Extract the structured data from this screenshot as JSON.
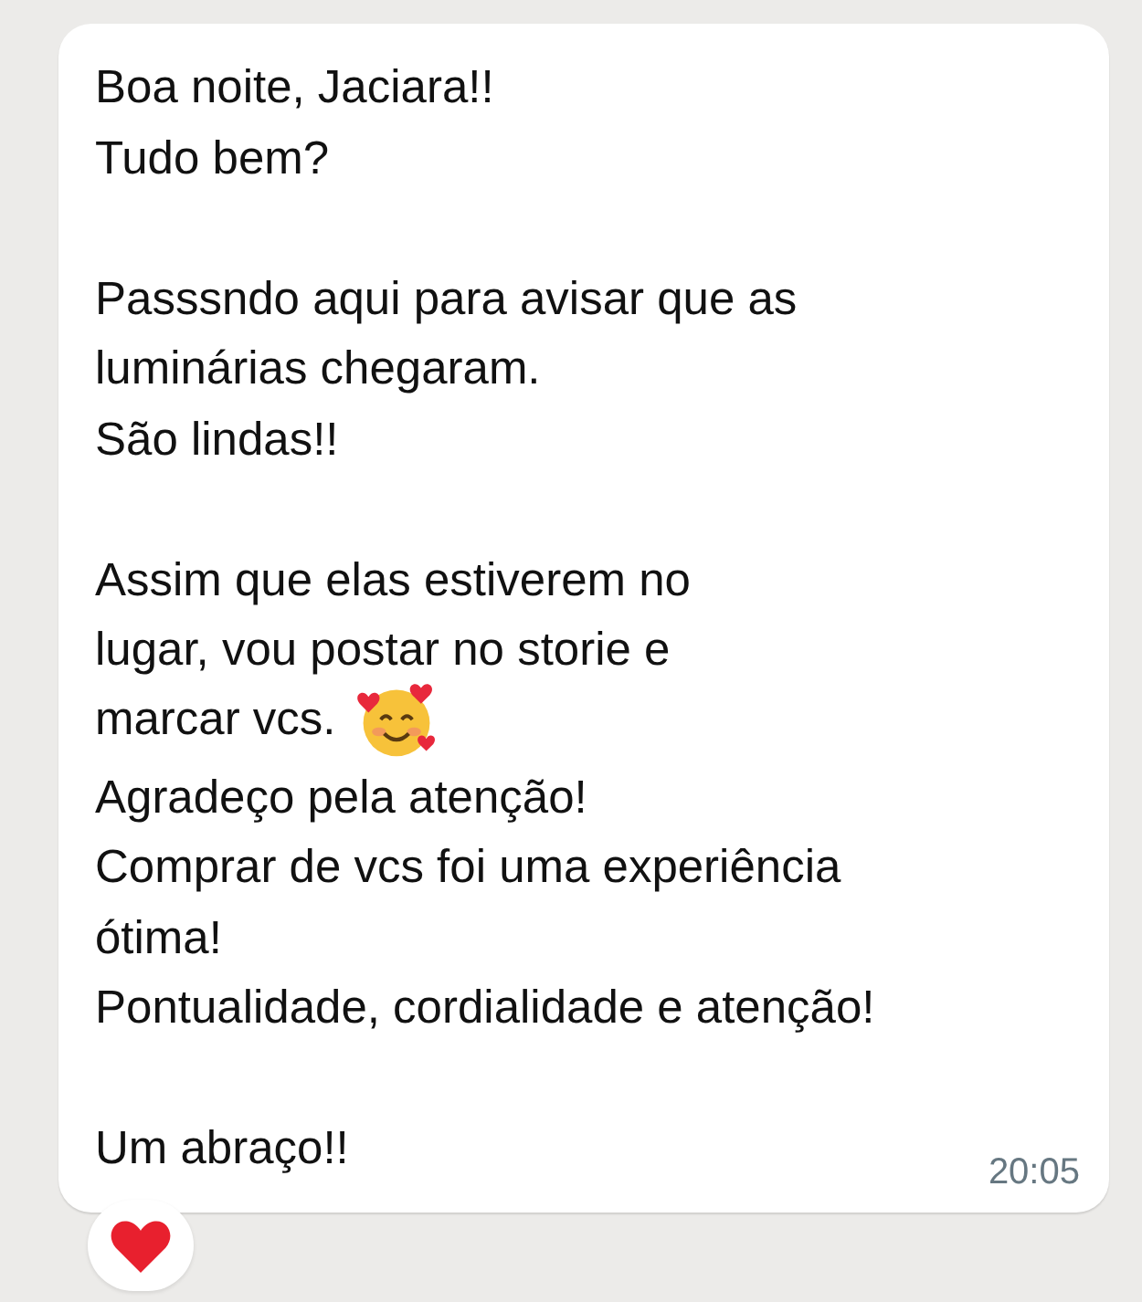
{
  "message": {
    "lines": [
      {
        "kind": "text",
        "text": "Boa noite, Jaciara!!"
      },
      {
        "kind": "text",
        "text": "Tudo bem?"
      },
      {
        "kind": "blank"
      },
      {
        "kind": "text",
        "text": "Passsndo aqui para avisar que as"
      },
      {
        "kind": "text",
        "text": "luminárias chegaram."
      },
      {
        "kind": "text",
        "text": "São lindas!!"
      },
      {
        "kind": "blank"
      },
      {
        "kind": "text",
        "text": "Assim que elas estiverem no"
      },
      {
        "kind": "text",
        "text": "lugar, vou postar no storie e"
      },
      {
        "kind": "emoji_end",
        "text": "marcar vcs."
      },
      {
        "kind": "text",
        "text": "Agradeço pela atenção!"
      },
      {
        "kind": "text",
        "text": "Comprar de vcs foi uma experiência"
      },
      {
        "kind": "text",
        "text": "ótima!"
      },
      {
        "kind": "text",
        "text": "Pontualidade, cordialidade e atenção!"
      },
      {
        "kind": "blank"
      },
      {
        "kind": "text",
        "text": "Um abraço!!"
      }
    ],
    "time": "20:05",
    "reaction": {
      "kind": "heart"
    }
  }
}
